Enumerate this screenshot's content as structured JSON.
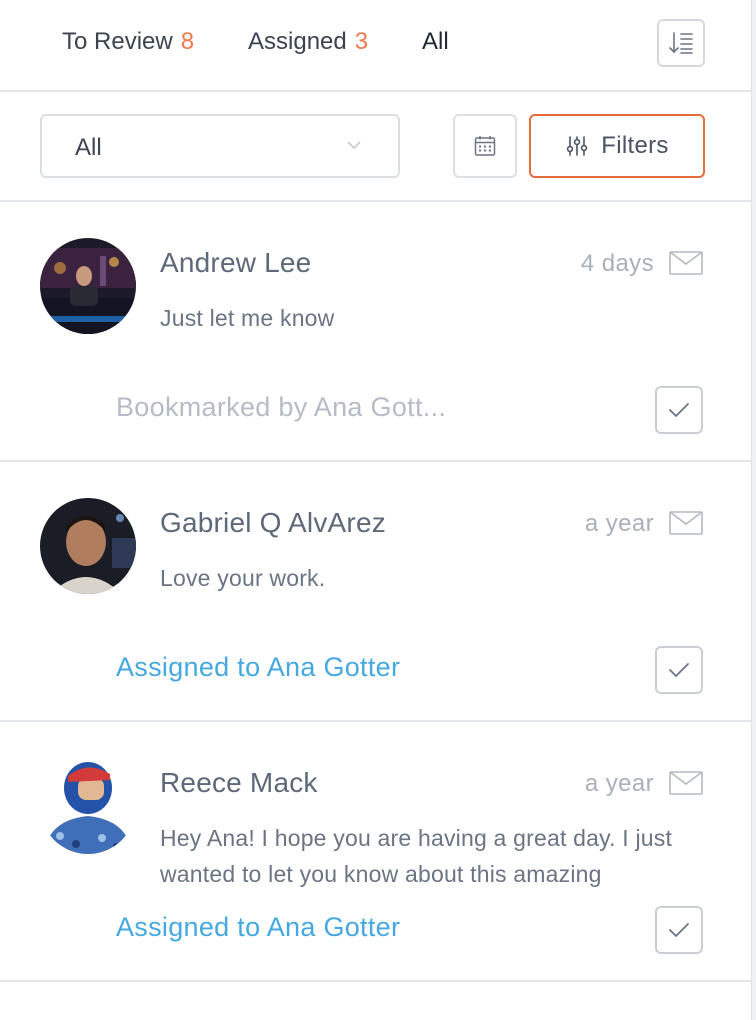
{
  "tabs": [
    {
      "label": "To Review",
      "count": "8"
    },
    {
      "label": "Assigned",
      "count": "3"
    },
    {
      "label": "All",
      "count": ""
    }
  ],
  "filter": {
    "select_value": "All",
    "filters_label": "Filters"
  },
  "icons": {
    "sort": "sort-list-icon",
    "calendar": "calendar-icon",
    "filters": "sliders-icon",
    "mail": "envelope-icon",
    "check": "checkmark-icon",
    "chevron": "chevron-down-icon"
  },
  "colors": {
    "accent_orange": "#e46c3f",
    "count_orange": "#ee7a4d",
    "assigned_blue": "#45a8e0",
    "muted_gray": "#b6bcc5"
  },
  "conversations": [
    {
      "name": "Andrew Lee",
      "time": "4 days",
      "message": "Just let me know",
      "status": "Bookmarked by Ana Gott..."
    },
    {
      "name": "Gabriel Q AlvArez",
      "time": "a year",
      "message": "Love your work.",
      "status": "Assigned to Ana Gotter"
    },
    {
      "name": "Reece Mack",
      "time": "a year",
      "message": "Hey Ana! I hope you are having a great day. I just wanted to let you know about this amazing",
      "status": "Assigned to Ana Gotter"
    }
  ]
}
